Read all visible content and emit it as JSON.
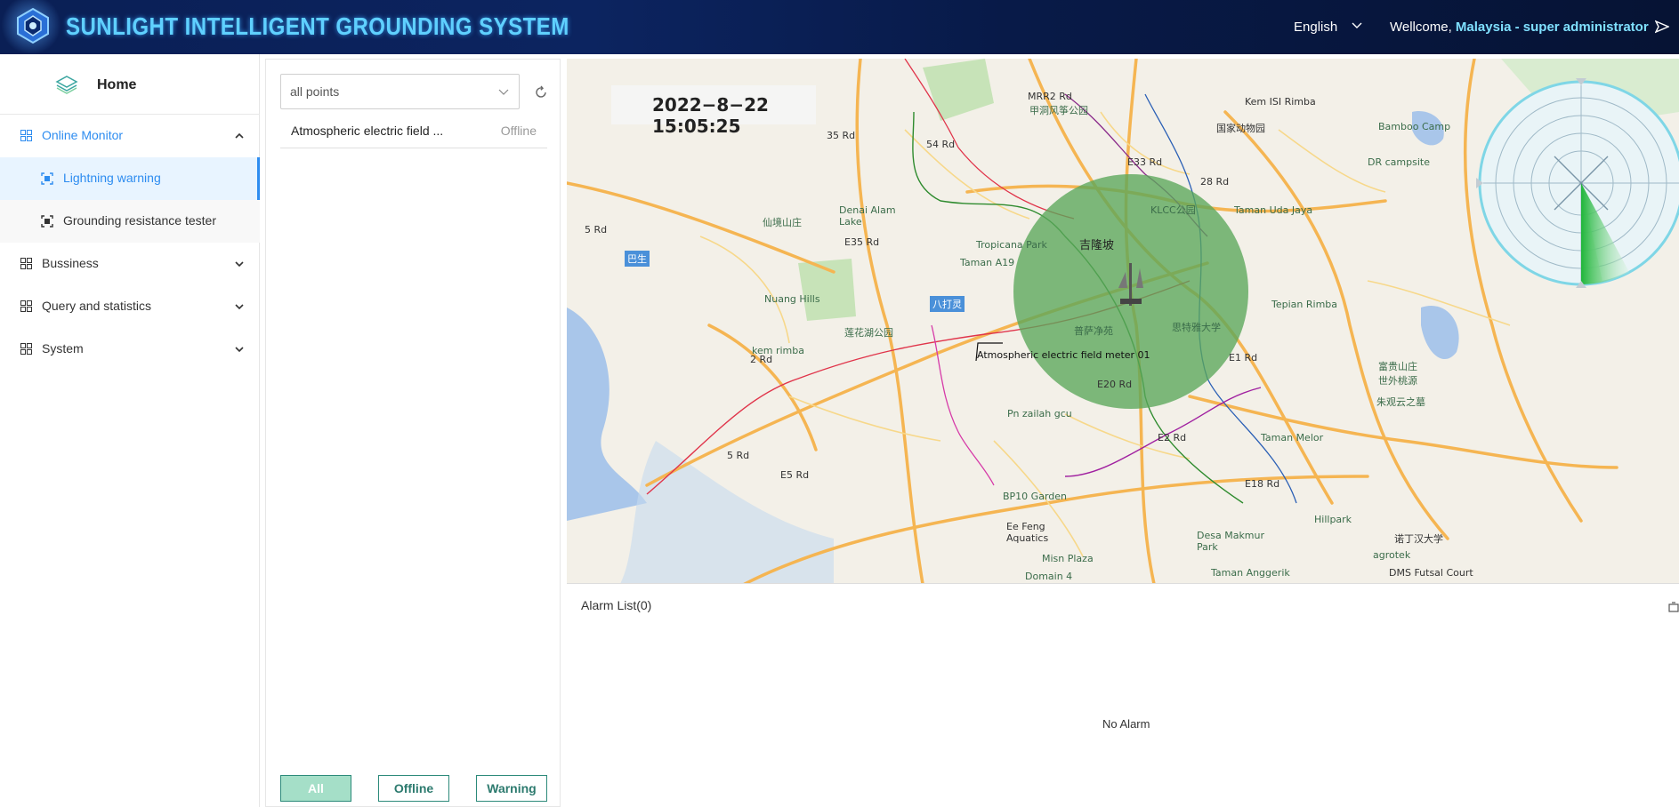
{
  "header": {
    "brand": "SUNLIGHT INTELLIGENT GROUNDING SYSTEM",
    "language": "English",
    "welcome_prefix": "Wellcome,",
    "user": "Malaysia - super administrator",
    "logo_icon": "chip-logo-icon",
    "logout_icon": "send-icon"
  },
  "sidebar": {
    "home_label": "Home",
    "menu": [
      {
        "label": "Online Monitor",
        "open": true
      },
      {
        "label": "Lightning warning",
        "active": true
      },
      {
        "label": "Grounding resistance tester"
      },
      {
        "label": "Bussiness"
      },
      {
        "label": "Query and statistics"
      },
      {
        "label": "System"
      }
    ]
  },
  "panel": {
    "select_value": "all points",
    "points": [
      {
        "name": "Atmospheric electric field ...",
        "status": "Offline"
      }
    ],
    "filters": [
      "All",
      "Offline",
      "Warning"
    ]
  },
  "map": {
    "timestamp": "2022−8−22 15:05:25",
    "marker_label": "Atmospheric electric field meter 01",
    "city_label": "吉隆坡",
    "badges": [
      "巴生",
      "八打灵"
    ],
    "pois": [
      "甲洞风筝公园",
      "Kem ISI Rimba",
      "国家动物园",
      "Bamboo Camp",
      "DR campsite",
      "KLCC公园",
      "Taman Uda Jaya",
      "仙境山庄",
      "Denai Alam Lake",
      "Tropicana Park",
      "Taman A19",
      "Nuang Hills",
      "莲花湖公园",
      "kem rimba",
      "普萨净苑",
      "思特雅大学",
      "Tepian Rimba",
      "富贵山庄 世外桃源",
      "朱观云之墓",
      "Pn zailah gcu",
      "Taman Melor",
      "BP10 Garden",
      "Ee Feng Aquatics",
      "Hillpark",
      "诺丁汉大学",
      "Desa Makmur Park",
      "agrotek",
      "Misn Plaza",
      "Domain 4",
      "Taman Anggerik",
      "DMS Futsal Court"
    ],
    "roads": [
      "35 Rd",
      "5 Rd",
      "E35 Rd",
      "2 Rd",
      "E5 Rd",
      "5 Rd",
      "E33 Rd",
      "E20 Rd",
      "E2 Rd",
      "E18 Rd",
      "MRR2 Rd",
      "28 Rd",
      "54 Rd",
      "E1 Rd"
    ],
    "circle_color": "#5aa65a",
    "radar_color": "#2cc040"
  },
  "alarm": {
    "title": "Alarm List(0)",
    "empty": "No Alarm"
  }
}
